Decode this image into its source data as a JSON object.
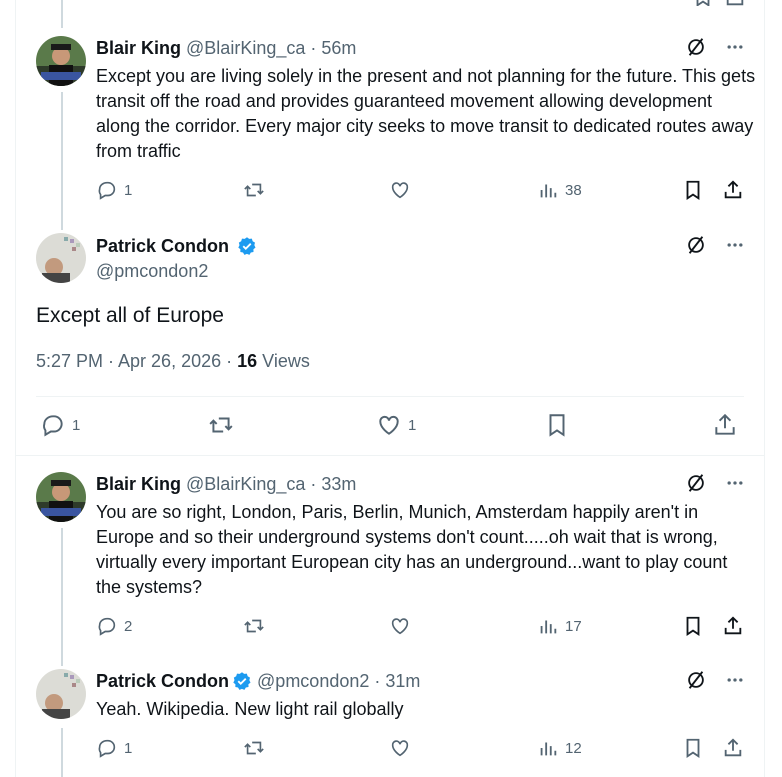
{
  "tweets": [
    {
      "name": "Blair King",
      "handle": "@BlairKing_ca",
      "separator": "·",
      "time": "56m",
      "text": "Except you are living solely in the present and not planning for the future. This gets transit off the road and provides guaranteed movement allowing development along the corridor. Every major city seeks to move transit to dedicated routes away from traffic",
      "replies": "1",
      "retweets": "",
      "likes": "",
      "views": "38"
    },
    {
      "name": "Blair King",
      "handle": "@BlairKing_ca",
      "separator": "·",
      "time": "33m",
      "text": "You are so right, London, Paris, Berlin, Munich, Amsterdam  happily aren't in Europe and so their underground systems don't count.....oh wait that is wrong, virtually every important European city has an underground...want to play count the systems?",
      "replies": "2",
      "retweets": "",
      "likes": "",
      "views": "17"
    },
    {
      "name": "Patrick Condon",
      "handle": "@pmcondon2",
      "separator": "·",
      "time": "31m",
      "text": "Yeah. Wikipedia. New light rail globally",
      "replies": "1",
      "retweets": "",
      "likes": "",
      "views": "12"
    }
  ],
  "main_tweet": {
    "name": "Patrick Condon",
    "handle": "@pmcondon2",
    "text": "Except all of Europe",
    "timestamp": "5:27 PM · Apr 26, 2026 · ",
    "views_count": "16",
    "views_label": " Views",
    "replies": "1",
    "retweets": "",
    "likes": "1"
  },
  "colors": {
    "text": "#0f1419",
    "muted": "#536471",
    "verified": "#1d9bf0",
    "border": "#eff3f4"
  },
  "icons": [
    "reply-icon",
    "retweet-icon",
    "like-icon",
    "views-icon",
    "bookmark-icon",
    "share-icon",
    "grok-icon",
    "more-icon",
    "verified-badge-icon"
  ]
}
